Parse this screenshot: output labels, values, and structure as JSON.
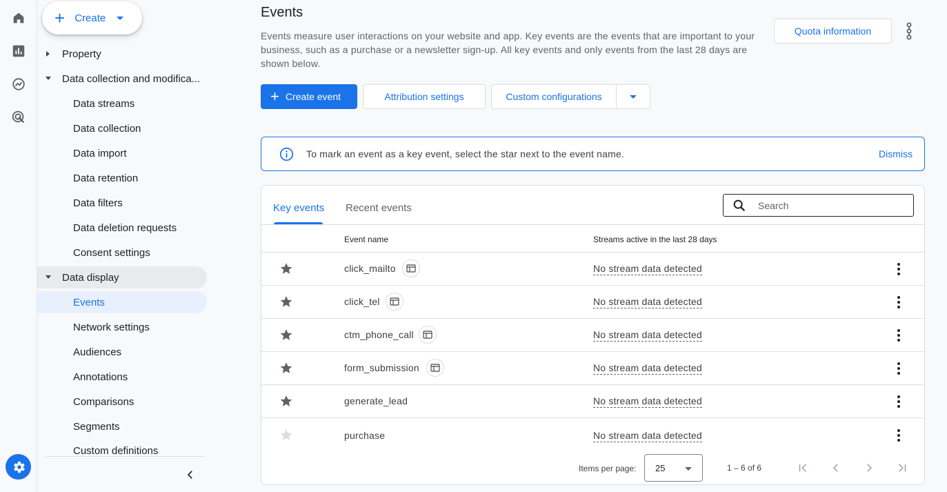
{
  "rail": {
    "icons": [
      "home-icon",
      "reports-icon",
      "explore-icon",
      "advertising-icon"
    ],
    "settings_icon": "gear-icon"
  },
  "nav": {
    "create_label": "Create",
    "items": [
      {
        "label": "Property",
        "level": "parent",
        "state": "collapsed"
      },
      {
        "label": "Data collection and modifica...",
        "level": "parent",
        "state": "expanded"
      },
      {
        "label": "Data streams",
        "level": "child"
      },
      {
        "label": "Data collection",
        "level": "child"
      },
      {
        "label": "Data import",
        "level": "child"
      },
      {
        "label": "Data retention",
        "level": "child"
      },
      {
        "label": "Data filters",
        "level": "child"
      },
      {
        "label": "Data deletion requests",
        "level": "child"
      },
      {
        "label": "Consent settings",
        "level": "child"
      },
      {
        "label": "Data display",
        "level": "parent",
        "state": "expanded"
      },
      {
        "label": "Events",
        "level": "child",
        "state": "active"
      },
      {
        "label": "Network settings",
        "level": "child"
      },
      {
        "label": "Audiences",
        "level": "child"
      },
      {
        "label": "Annotations",
        "level": "child"
      },
      {
        "label": "Comparisons",
        "level": "child"
      },
      {
        "label": "Segments",
        "level": "child"
      },
      {
        "label": "Custom definitions",
        "level": "child"
      }
    ]
  },
  "main": {
    "title": "Events",
    "description": "Events measure user interactions on your website and app. Key events are the events that are important to your business, such as a purchase or a newsletter sign-up. All key events and only events from the last 28 days are shown below.",
    "quota_label": "Quota information",
    "create_event_label": "Create event",
    "attribution_label": "Attribution settings",
    "custom_config_label": "Custom configurations",
    "banner_text": "To mark an event as a key event, select the star next to the event name.",
    "dismiss_label": "Dismiss",
    "accent_color": "#1a73e8"
  },
  "table": {
    "tabs": [
      "Key events",
      "Recent events"
    ],
    "search_placeholder": "Search",
    "headers": {
      "name": "Event name",
      "streams": "Streams active in the last 28 days"
    },
    "rows": [
      {
        "name": "click_mailto",
        "streams": "No stream data detected",
        "starred": true,
        "chip": true
      },
      {
        "name": "click_tel",
        "streams": "No stream data detected",
        "starred": true,
        "chip": true
      },
      {
        "name": "ctm_phone_call",
        "streams": "No stream data detected",
        "starred": true,
        "chip": true
      },
      {
        "name": "form_submission",
        "streams": "No stream data detected",
        "starred": true,
        "chip": true
      },
      {
        "name": "generate_lead",
        "streams": "No stream data detected",
        "starred": true,
        "chip": false
      },
      {
        "name": "purchase",
        "streams": "No stream data detected",
        "starred": false,
        "chip": false
      }
    ],
    "pager": {
      "items_label": "Items per page:",
      "page_size": "25",
      "range": "1 – 6 of 6"
    }
  }
}
